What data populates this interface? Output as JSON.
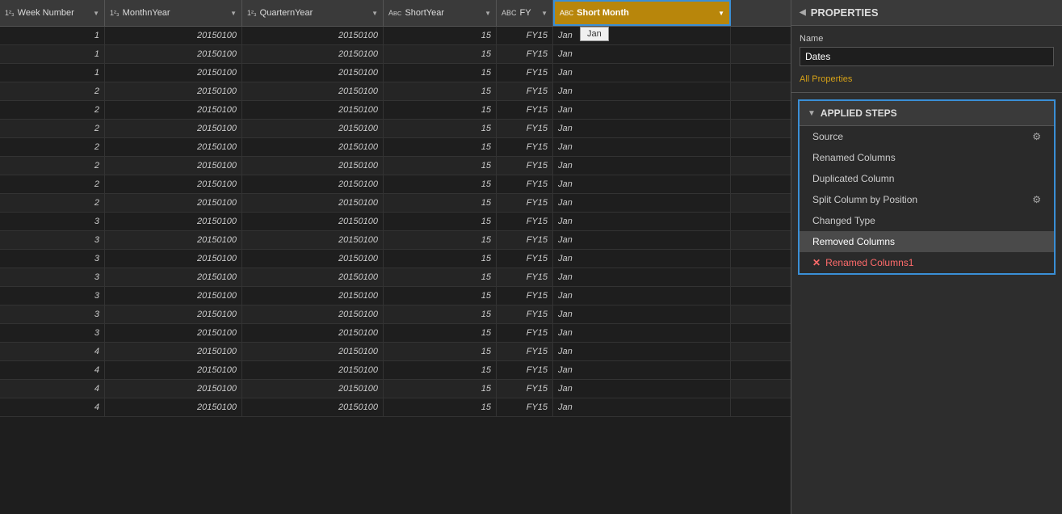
{
  "columns": [
    {
      "id": "week-number",
      "label": "Week Number",
      "type": "123",
      "class": "week-number"
    },
    {
      "id": "month-year",
      "label": "MonthnYear",
      "type": "123",
      "class": "month-year"
    },
    {
      "id": "quarter-year",
      "label": "QuarternYear",
      "type": "123",
      "class": "quarter-year"
    },
    {
      "id": "short-year",
      "label": "ShortYear",
      "type": "ABC",
      "class": "short-year"
    },
    {
      "id": "fy",
      "label": "FY",
      "type": "ABC",
      "class": "fy"
    },
    {
      "id": "short-month",
      "label": "Short Month",
      "type": "ABC",
      "class": "short-month",
      "active": true
    }
  ],
  "rows": [
    {
      "week": "1",
      "monthYear": "20150100",
      "quarterYear": "20150100",
      "shortYear": "15",
      "fy": "FY15",
      "shortMonth": "Jan"
    },
    {
      "week": "1",
      "monthYear": "20150100",
      "quarterYear": "20150100",
      "shortYear": "15",
      "fy": "FY15",
      "shortMonth": "Jan"
    },
    {
      "week": "1",
      "monthYear": "20150100",
      "quarterYear": "20150100",
      "shortYear": "15",
      "fy": "FY15",
      "shortMonth": "Jan"
    },
    {
      "week": "2",
      "monthYear": "20150100",
      "quarterYear": "20150100",
      "shortYear": "15",
      "fy": "FY15",
      "shortMonth": "Jan"
    },
    {
      "week": "2",
      "monthYear": "20150100",
      "quarterYear": "20150100",
      "shortYear": "15",
      "fy": "FY15",
      "shortMonth": "Jan"
    },
    {
      "week": "2",
      "monthYear": "20150100",
      "quarterYear": "20150100",
      "shortYear": "15",
      "fy": "FY15",
      "shortMonth": "Jan"
    },
    {
      "week": "2",
      "monthYear": "20150100",
      "quarterYear": "20150100",
      "shortYear": "15",
      "fy": "FY15",
      "shortMonth": "Jan"
    },
    {
      "week": "2",
      "monthYear": "20150100",
      "quarterYear": "20150100",
      "shortYear": "15",
      "fy": "FY15",
      "shortMonth": "Jan"
    },
    {
      "week": "2",
      "monthYear": "20150100",
      "quarterYear": "20150100",
      "shortYear": "15",
      "fy": "FY15",
      "shortMonth": "Jan"
    },
    {
      "week": "2",
      "monthYear": "20150100",
      "quarterYear": "20150100",
      "shortYear": "15",
      "fy": "FY15",
      "shortMonth": "Jan"
    },
    {
      "week": "3",
      "monthYear": "20150100",
      "quarterYear": "20150100",
      "shortYear": "15",
      "fy": "FY15",
      "shortMonth": "Jan"
    },
    {
      "week": "3",
      "monthYear": "20150100",
      "quarterYear": "20150100",
      "shortYear": "15",
      "fy": "FY15",
      "shortMonth": "Jan"
    },
    {
      "week": "3",
      "monthYear": "20150100",
      "quarterYear": "20150100",
      "shortYear": "15",
      "fy": "FY15",
      "shortMonth": "Jan"
    },
    {
      "week": "3",
      "monthYear": "20150100",
      "quarterYear": "20150100",
      "shortYear": "15",
      "fy": "FY15",
      "shortMonth": "Jan"
    },
    {
      "week": "3",
      "monthYear": "20150100",
      "quarterYear": "20150100",
      "shortYear": "15",
      "fy": "FY15",
      "shortMonth": "Jan"
    },
    {
      "week": "3",
      "monthYear": "20150100",
      "quarterYear": "20150100",
      "shortYear": "15",
      "fy": "FY15",
      "shortMonth": "Jan"
    },
    {
      "week": "3",
      "monthYear": "20150100",
      "quarterYear": "20150100",
      "shortYear": "15",
      "fy": "FY15",
      "shortMonth": "Jan"
    },
    {
      "week": "4",
      "monthYear": "20150100",
      "quarterYear": "20150100",
      "shortYear": "15",
      "fy": "FY15",
      "shortMonth": "Jan"
    },
    {
      "week": "4",
      "monthYear": "20150100",
      "quarterYear": "20150100",
      "shortYear": "15",
      "fy": "FY15",
      "shortMonth": "Jan"
    },
    {
      "week": "4",
      "monthYear": "20150100",
      "quarterYear": "20150100",
      "shortYear": "15",
      "fy": "FY15",
      "shortMonth": "Jan"
    },
    {
      "week": "4",
      "monthYear": "20150100",
      "quarterYear": "20150100",
      "shortYear": "15",
      "fy": "FY15",
      "shortMonth": "Jan"
    }
  ],
  "properties": {
    "section_title": "PROPERTIES",
    "name_label": "Name",
    "name_value": "Dates",
    "all_properties_text": "All Properties"
  },
  "applied_steps": {
    "section_title": "APPLIED STEPS",
    "steps": [
      {
        "id": "source",
        "label": "Source",
        "has_gear": true,
        "is_active": false,
        "has_error": false
      },
      {
        "id": "renamed-columns",
        "label": "Renamed Columns",
        "has_gear": false,
        "is_active": false,
        "has_error": false
      },
      {
        "id": "duplicated-column",
        "label": "Duplicated Column",
        "has_gear": false,
        "is_active": false,
        "has_error": false
      },
      {
        "id": "split-column-by-position",
        "label": "Split Column by Position",
        "has_gear": true,
        "is_active": false,
        "has_error": false
      },
      {
        "id": "changed-type",
        "label": "Changed Type",
        "has_gear": false,
        "is_active": false,
        "has_error": false
      },
      {
        "id": "removed-columns",
        "label": "Removed Columns",
        "has_gear": false,
        "is_active": true,
        "has_error": false
      },
      {
        "id": "renamed-columns1",
        "label": "Renamed Columns1",
        "has_gear": false,
        "is_active": false,
        "has_error": true
      }
    ]
  },
  "tooltip": {
    "text": "Jan"
  }
}
